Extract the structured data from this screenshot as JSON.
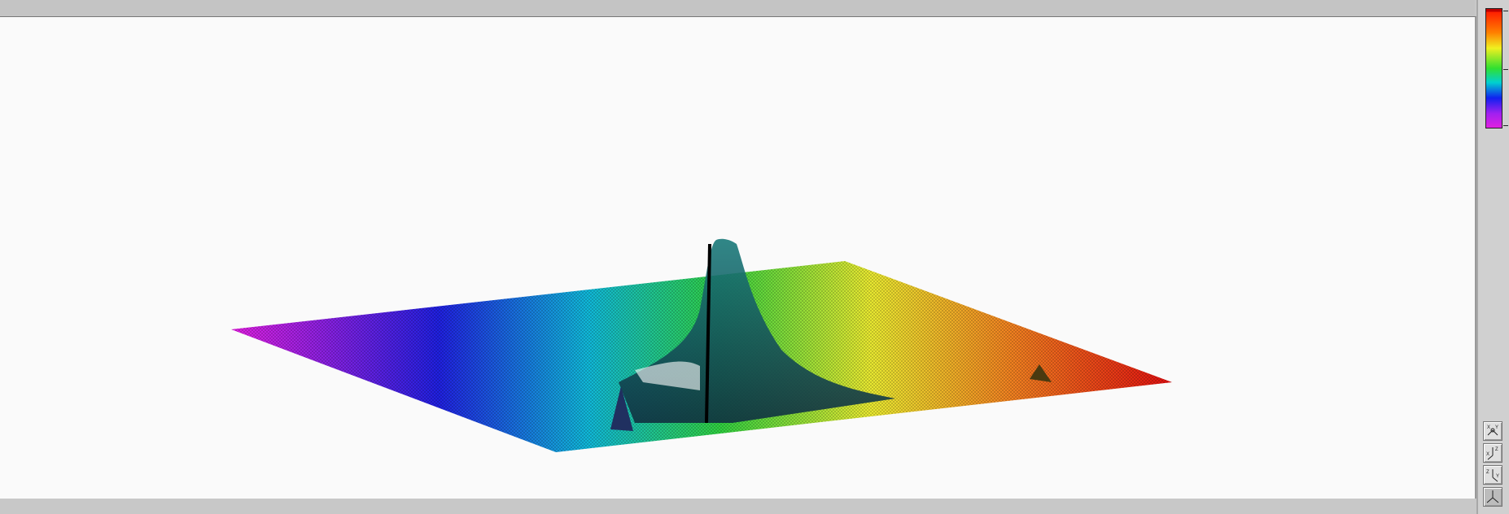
{
  "chart_data": {
    "type": "surface",
    "title": "",
    "colormap": [
      "#e020e0",
      "#2020e0",
      "#00c0e0",
      "#20e020",
      "#f0f020",
      "#ff8000",
      "#e00000"
    ],
    "colorbar": {
      "min_color": "#e020e0",
      "max_color": "#e00000"
    },
    "features": [
      {
        "name": "main-peak",
        "relative_height": 1.0
      },
      {
        "name": "small-peak-left",
        "relative_height": 0.15
      },
      {
        "name": "small-peak-right",
        "relative_height": 0.05
      }
    ]
  },
  "view_buttons": [
    "xy-view-icon",
    "xz-view-icon",
    "yz-view-icon",
    "default-3d-view-icon"
  ]
}
